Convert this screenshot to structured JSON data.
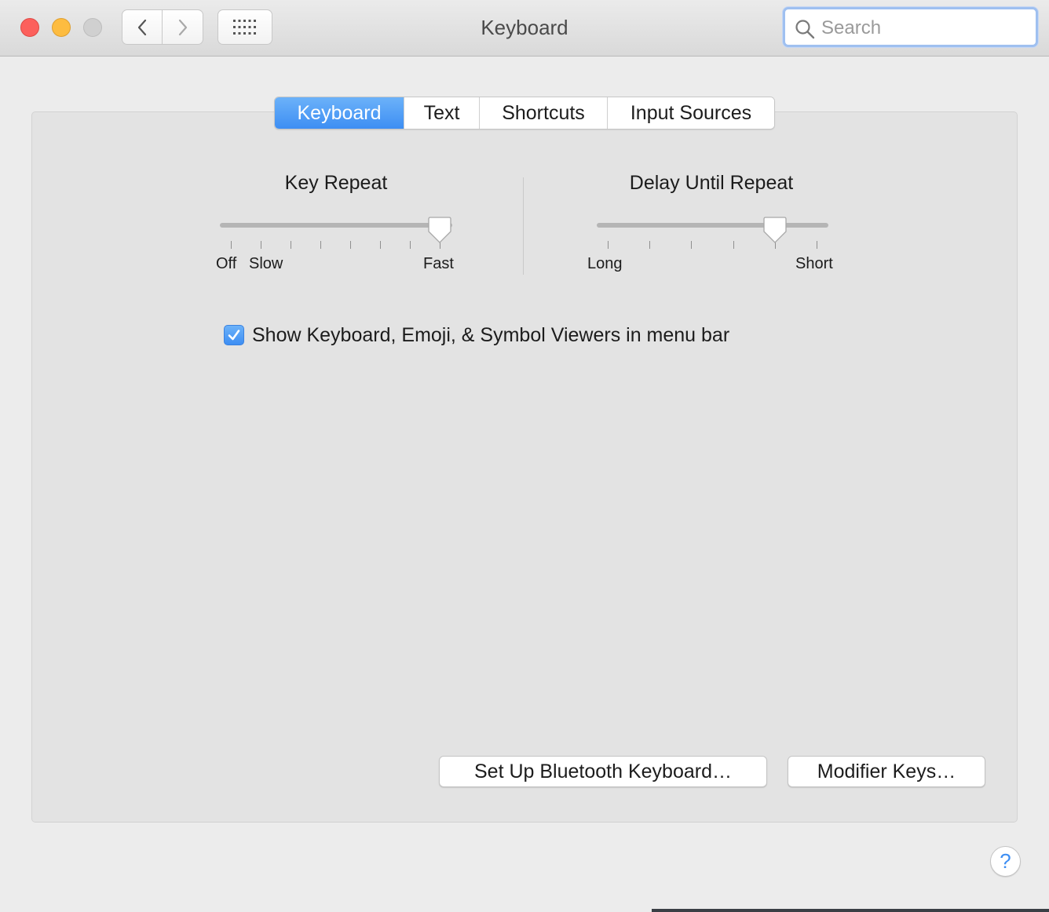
{
  "window": {
    "title": "Keyboard",
    "search_placeholder": "Search"
  },
  "toolbar": {
    "back_icon": "chevron-left-icon",
    "forward_icon": "chevron-right-icon",
    "show_all_icon": "grid-icon"
  },
  "tabs": [
    {
      "label": "Keyboard",
      "selected": true
    },
    {
      "label": "Text",
      "selected": false
    },
    {
      "label": "Shortcuts",
      "selected": false
    },
    {
      "label": "Input Sources",
      "selected": false
    }
  ],
  "key_repeat": {
    "title": "Key Repeat",
    "labels": {
      "off": "Off",
      "slow": "Slow",
      "fast": "Fast"
    },
    "tick_count": 8,
    "value_fraction": 1.0
  },
  "delay_until_repeat": {
    "title": "Delay Until Repeat",
    "labels": {
      "long": "Long",
      "short": "Short"
    },
    "tick_count": 6,
    "value_fraction": 0.8
  },
  "show_viewers": {
    "label": "Show Keyboard, Emoji, & Symbol Viewers in menu bar",
    "checked": true
  },
  "buttons": {
    "bluetooth": "Set Up Bluetooth Keyboard…",
    "modifier": "Modifier Keys…",
    "help": "?"
  },
  "colors": {
    "accent": "#3d8ef3",
    "close": "#fc605c",
    "minimize": "#fdbc40",
    "zoom_disabled": "#d0d0d0"
  }
}
